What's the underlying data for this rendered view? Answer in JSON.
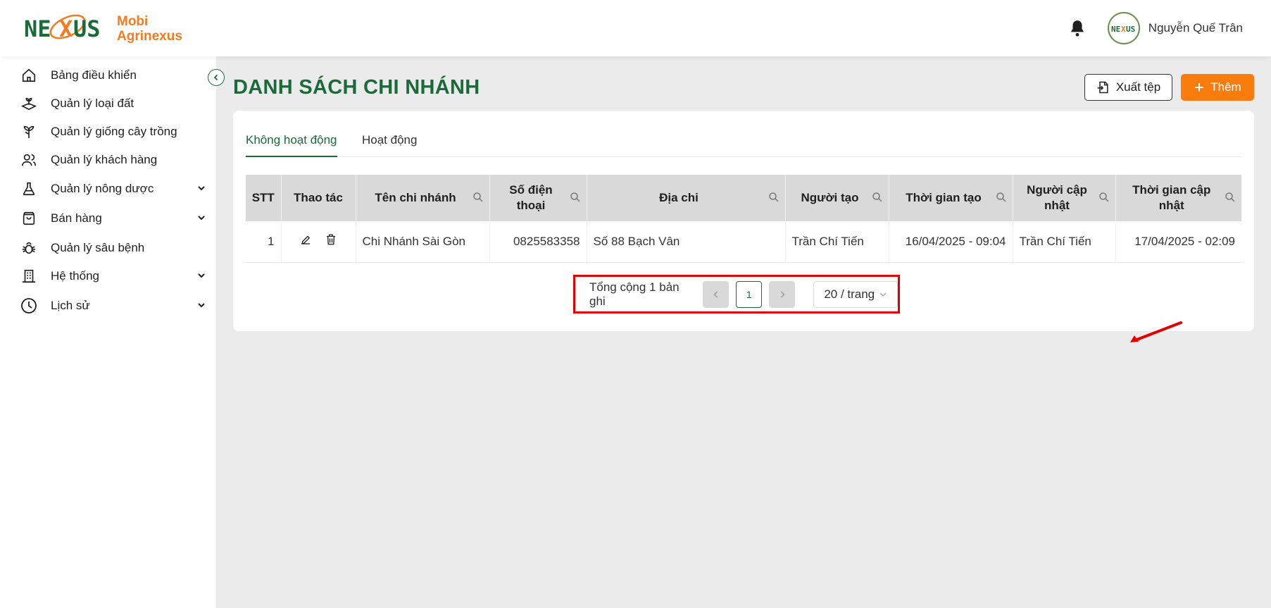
{
  "brand": {
    "line1": "Mobi",
    "line2": "Agrinexus",
    "logo_text": "NEXUS",
    "accent": "#f47b20",
    "primary": "#1b6b3a"
  },
  "header": {
    "user_name": "Nguyễn Quế Trân",
    "avatar_text": "NEXUS"
  },
  "sidebar": {
    "items": [
      {
        "label": "Bảng điều khiển",
        "icon": "home-icon",
        "has_children": false
      },
      {
        "label": "Quản lý loại đất",
        "icon": "soil-icon",
        "has_children": false
      },
      {
        "label": "Quản lý giống cây trồng",
        "icon": "plant-icon",
        "has_children": false
      },
      {
        "label": "Quản lý khách hàng",
        "icon": "users-icon",
        "has_children": false
      },
      {
        "label": "Quản lý nông dược",
        "icon": "flask-icon",
        "has_children": true
      },
      {
        "label": "Bán hàng",
        "icon": "shopping-bag-icon",
        "has_children": true
      },
      {
        "label": "Quản lý sâu bệnh",
        "icon": "bug-icon",
        "has_children": false
      },
      {
        "label": "Hệ thống",
        "icon": "building-icon",
        "has_children": true
      },
      {
        "label": "Lịch sử",
        "icon": "clock-icon",
        "has_children": true
      }
    ]
  },
  "page": {
    "title": "DANH SÁCH CHI NHÁNH",
    "export_label": "Xuất tệp",
    "add_label": "Thêm"
  },
  "tabs": [
    {
      "label": "Không hoạt động",
      "active": true
    },
    {
      "label": "Hoạt động",
      "active": false
    }
  ],
  "table": {
    "columns": [
      "STT",
      "Thao tác",
      "Tên chi nhánh",
      "Số điện thoại",
      "Địa chi",
      "Người tạo",
      "Thời gian tạo",
      "Người cập nhật",
      "Thời gian cập nhật"
    ],
    "rows": [
      {
        "stt": "1",
        "branch_name": "Chi Nhánh Sài Gòn",
        "phone": "0825583358",
        "address": "Số 88 Bạch Vân",
        "creator": "Trần Chí Tiến",
        "created_at": "16/04/2025 - 09:04",
        "updater": "Trần Chí Tiến",
        "updated_at": "17/04/2025 - 02:09"
      }
    ]
  },
  "pagination": {
    "total_text": "Tổng cộng 1 bản ghi",
    "current_page": "1",
    "page_size": "20 / trang"
  }
}
